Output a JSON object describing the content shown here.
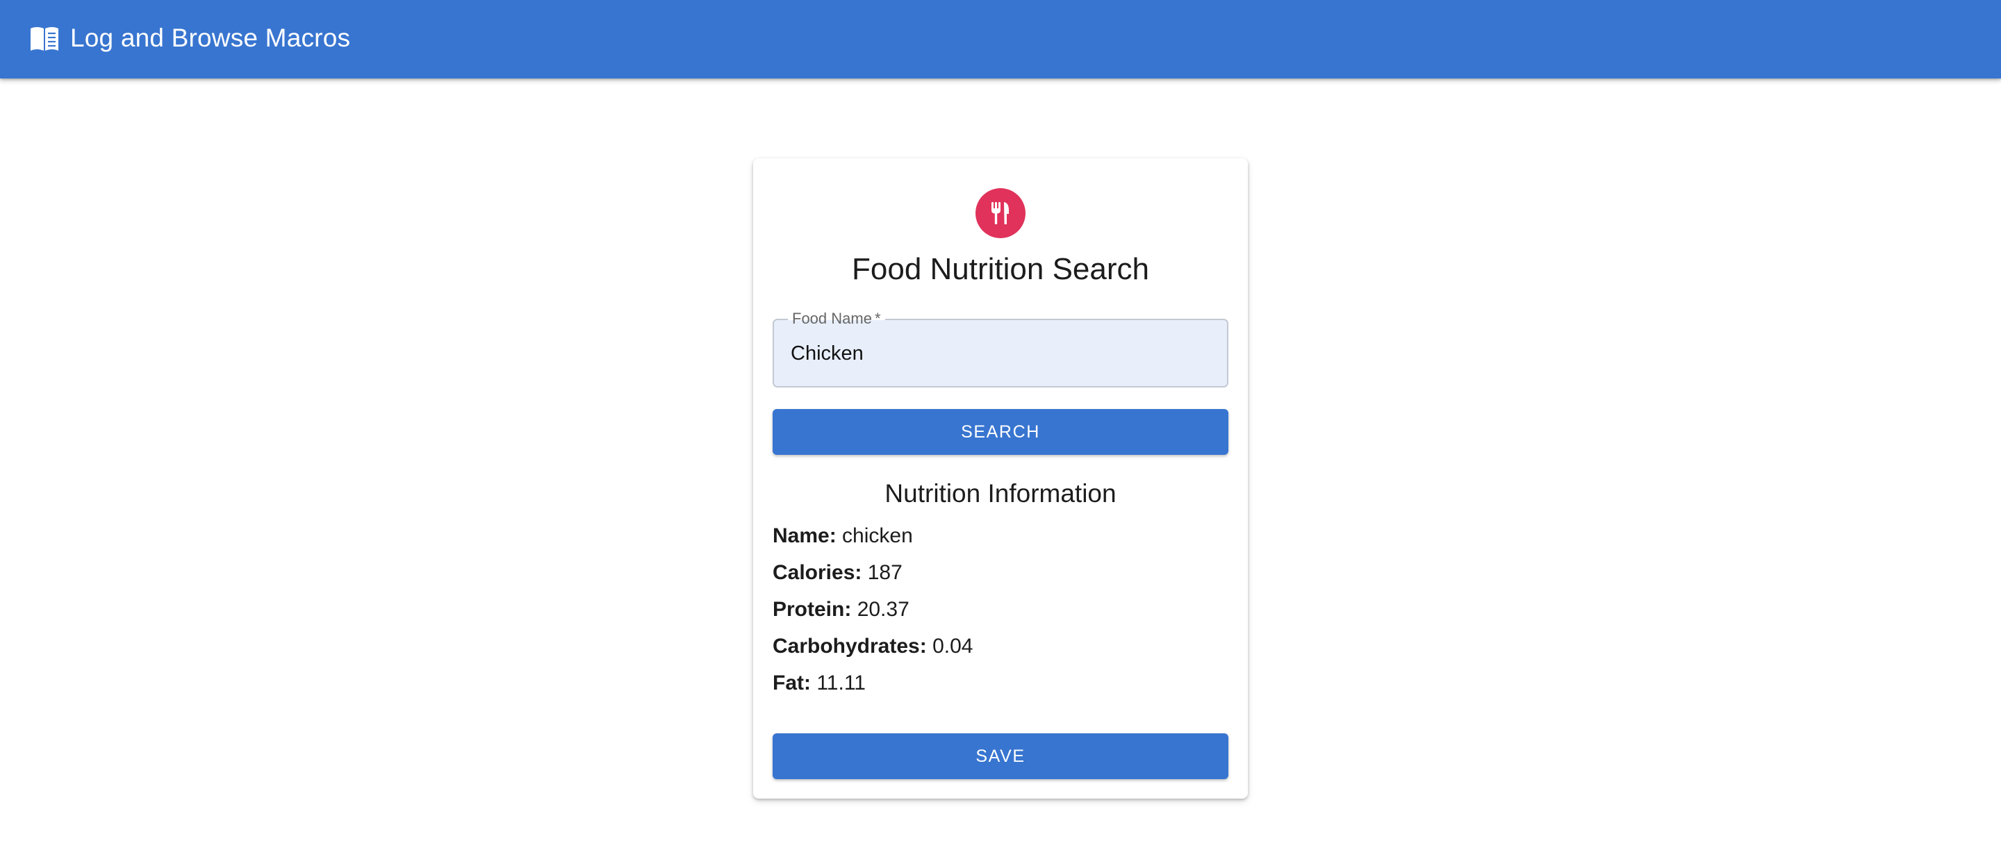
{
  "colors": {
    "primary": "#3875d0",
    "accent": "#e0325a"
  },
  "appbar": {
    "icon": "menu-book-icon",
    "title": "Log and Browse Macros"
  },
  "card": {
    "icon": "restaurant-icon",
    "title": "Food Nutrition Search",
    "food_field": {
      "label": "Food Name",
      "required_marker": "*",
      "value": "Chicken",
      "placeholder": ""
    },
    "search_label": "Search",
    "section_title": "Nutrition Information",
    "nutrition": [
      {
        "label": "Name:",
        "value": "chicken"
      },
      {
        "label": "Calories:",
        "value": "187"
      },
      {
        "label": "Protein:",
        "value": "20.37"
      },
      {
        "label": "Carbohydrates:",
        "value": "0.04"
      },
      {
        "label": "Fat:",
        "value": "11.11"
      }
    ],
    "save_label": "Save"
  }
}
